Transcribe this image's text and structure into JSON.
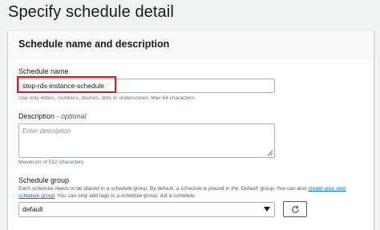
{
  "page": {
    "title": "Specify schedule detail"
  },
  "section": {
    "title": "Schedule name and description"
  },
  "schedule_name": {
    "label": "Schedule name",
    "value": "stop-rds-instance-schedule",
    "hint": "Use only letters, numbers, dashes, dots or underscores. Max 64 characters."
  },
  "description": {
    "label": "Description",
    "optional_label": " - optional",
    "placeholder": "Enter description",
    "hint": "Maximum of 512 characters."
  },
  "schedule_group": {
    "label": "Schedule group",
    "desc_part1": "Each schedule needs to be placed in a schedule group. By default, a schedule is placed in the 'Default' group. You can also ",
    "link_text": "create your own schedule group",
    "desc_part2": ". You can only add tags to a schedule group, not a schedule.",
    "selected": "default",
    "refresh_icon": "refresh-icon",
    "caret_icon": "caret-down-icon"
  },
  "colors": {
    "highlight": "#e0161f",
    "link": "#0073bb",
    "background": "#f2f3f3"
  }
}
